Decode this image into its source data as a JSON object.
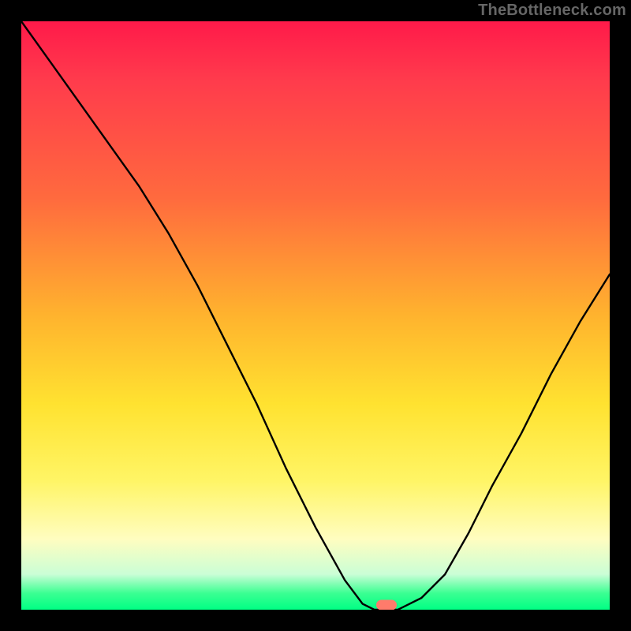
{
  "watermark": {
    "text": "TheBottleneck.com"
  },
  "colors": {
    "background_black": "#000000",
    "curve_stroke": "#000000",
    "marker_fill": "#ff7b6b",
    "gradient_top": "#ff1a4a",
    "gradient_bottom": "#00ff84"
  },
  "chart_data": {
    "type": "line",
    "title": "",
    "xlabel": "",
    "ylabel": "",
    "xlim": [
      0,
      100
    ],
    "ylim": [
      0,
      100
    ],
    "x": [
      0,
      5,
      10,
      15,
      20,
      25,
      30,
      35,
      40,
      45,
      50,
      55,
      58,
      60,
      62,
      64,
      68,
      72,
      76,
      80,
      85,
      90,
      95,
      100
    ],
    "values": [
      100,
      93,
      86,
      79,
      72,
      64,
      55,
      45,
      35,
      24,
      14,
      5,
      1,
      0,
      0,
      0,
      2,
      6,
      13,
      21,
      30,
      40,
      49,
      57
    ],
    "bottleneck_minimum_x": 62,
    "bottleneck_minimum_y": 0,
    "marker": {
      "x": 62,
      "y": 0
    }
  }
}
